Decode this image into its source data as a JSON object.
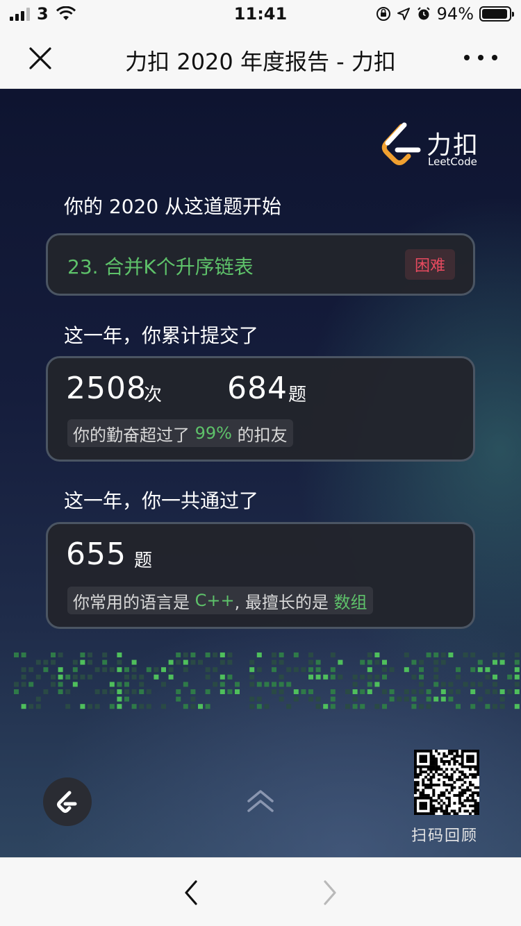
{
  "status_bar": {
    "carrier": "3",
    "time": "11:41",
    "battery_percent": "94%",
    "battery_level": 0.94,
    "icons": [
      "signal-icon",
      "wifi-icon",
      "orientation-lock-icon",
      "location-icon",
      "alarm-icon",
      "battery-icon"
    ]
  },
  "nav": {
    "title": "力扣 2020 年度报告 - 力扣",
    "close_icon": "close-icon",
    "more_icon": "more-icon"
  },
  "logo": {
    "cn": "力扣",
    "en": "LeetCode"
  },
  "first_problem": {
    "label": "你的 2020 从这道题开始",
    "title": "23. 合并K个升序链表",
    "difficulty": "困难"
  },
  "submissions": {
    "label": "这一年，你累计提交了",
    "count": "2508",
    "count_unit": "次",
    "problems": "684",
    "problems_unit": "题",
    "beat_prefix": "你的勤奋超过了 ",
    "beat_percent": "99%",
    "beat_suffix": " 的扣友"
  },
  "passed": {
    "label": "这一年，你一共通过了",
    "count": "655",
    "unit": "题",
    "lang_prefix": "你常用的语言是 ",
    "language": "C++",
    "lang_mid": ", 最擅长的是 ",
    "skill": "数组"
  },
  "footer": {
    "qr_label": "扫码回顾"
  },
  "colors": {
    "accent_green": "#5ec26a",
    "hard_red": "#e84a5f",
    "logo_orange": "#f0a030"
  }
}
